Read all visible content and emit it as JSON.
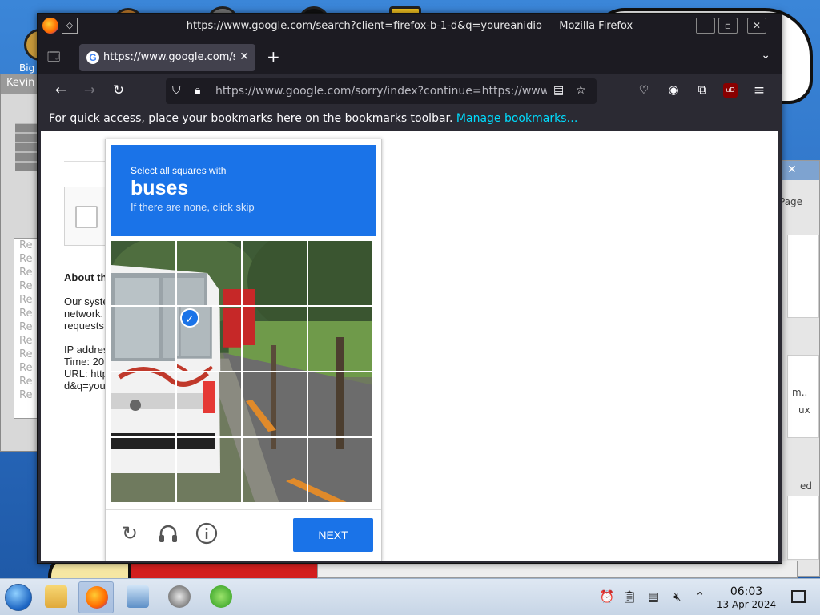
{
  "desktop": {
    "icon_label": "Big"
  },
  "bg_window_left": {
    "title": "Kevin",
    "list_items": [
      "Re",
      "Re",
      "Re",
      "Re",
      "Re",
      "Re",
      "Re",
      "Re",
      "Re",
      "Re",
      "Re",
      "Re"
    ]
  },
  "bg_window_right": {
    "text_page": "Page",
    "text_m": "m..",
    "text_ux": "ux",
    "text_ed": "ed"
  },
  "firefox": {
    "window_title": "https://www.google.com/search?client=firefox-b-1-d&q=youreanidio — Mozilla Firefox",
    "tab": {
      "favicon": "G",
      "label": "https://www.google.com/s"
    },
    "url": "https://www.google.com/sorry/index?continue=https://www.google.com/search",
    "bookmarks_text": "For quick access, place your bookmarks here on the bookmarks toolbar.",
    "bookmarks_link": "Manage bookmarks…"
  },
  "page": {
    "about_heading": "About th",
    "para_lines": [
      "Our syste",
      "network.",
      "requests"
    ],
    "ip_line": "IP addres",
    "time_line": "Time: 20",
    "url_line": "URL: http",
    "url_line2": "d&q=you"
  },
  "captcha": {
    "instruction_small": "Select all squares with",
    "target": "buses",
    "instruction_sub": "If there are none, click skip",
    "selected_tiles": [
      5
    ],
    "next_label": "NEXT",
    "icons": [
      "reload-icon",
      "headphones-icon",
      "info-icon"
    ]
  },
  "taskbar": {
    "time": "06:03",
    "date": "13 Apr 2024"
  },
  "colors": {
    "captcha_blue": "#1a73e8",
    "firefox_dark": "#1c1b22",
    "link_cyan": "#00ddff"
  }
}
